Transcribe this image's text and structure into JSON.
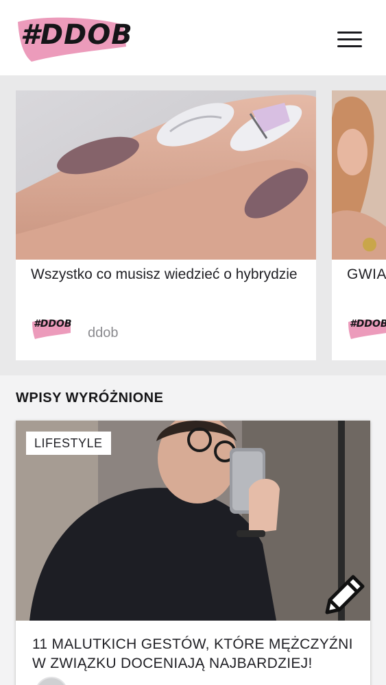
{
  "header": {
    "logo_text": "#DDOB",
    "menu_icon": "hamburger-menu-icon"
  },
  "carousel": {
    "cards": [
      {
        "title": "Wszystko co musisz wiedzieć o hybrydzie",
        "author_logo": "#DDOB",
        "author": "ddob"
      },
      {
        "title": "GWIA SOCIA",
        "author_logo": "#DDOB"
      }
    ]
  },
  "featured": {
    "section_title": "WPISY WYRÓŻNIONE",
    "post": {
      "category": "LIFESTYLE",
      "title": "11 MALUTKICH GESTÓW, KTÓRE MĘŻCZYŹNI W ZWIĄZKU DOCENIAJĄ NAJBARDZIEJ!",
      "edit_icon": "pencil-icon"
    }
  },
  "colors": {
    "brand_pink": "#ec9bbb",
    "page_bg": "#f3f3f4",
    "carousel_bg": "#e9e9ea",
    "text_dark": "#1f1f24",
    "text_muted": "#8a8a8e"
  }
}
